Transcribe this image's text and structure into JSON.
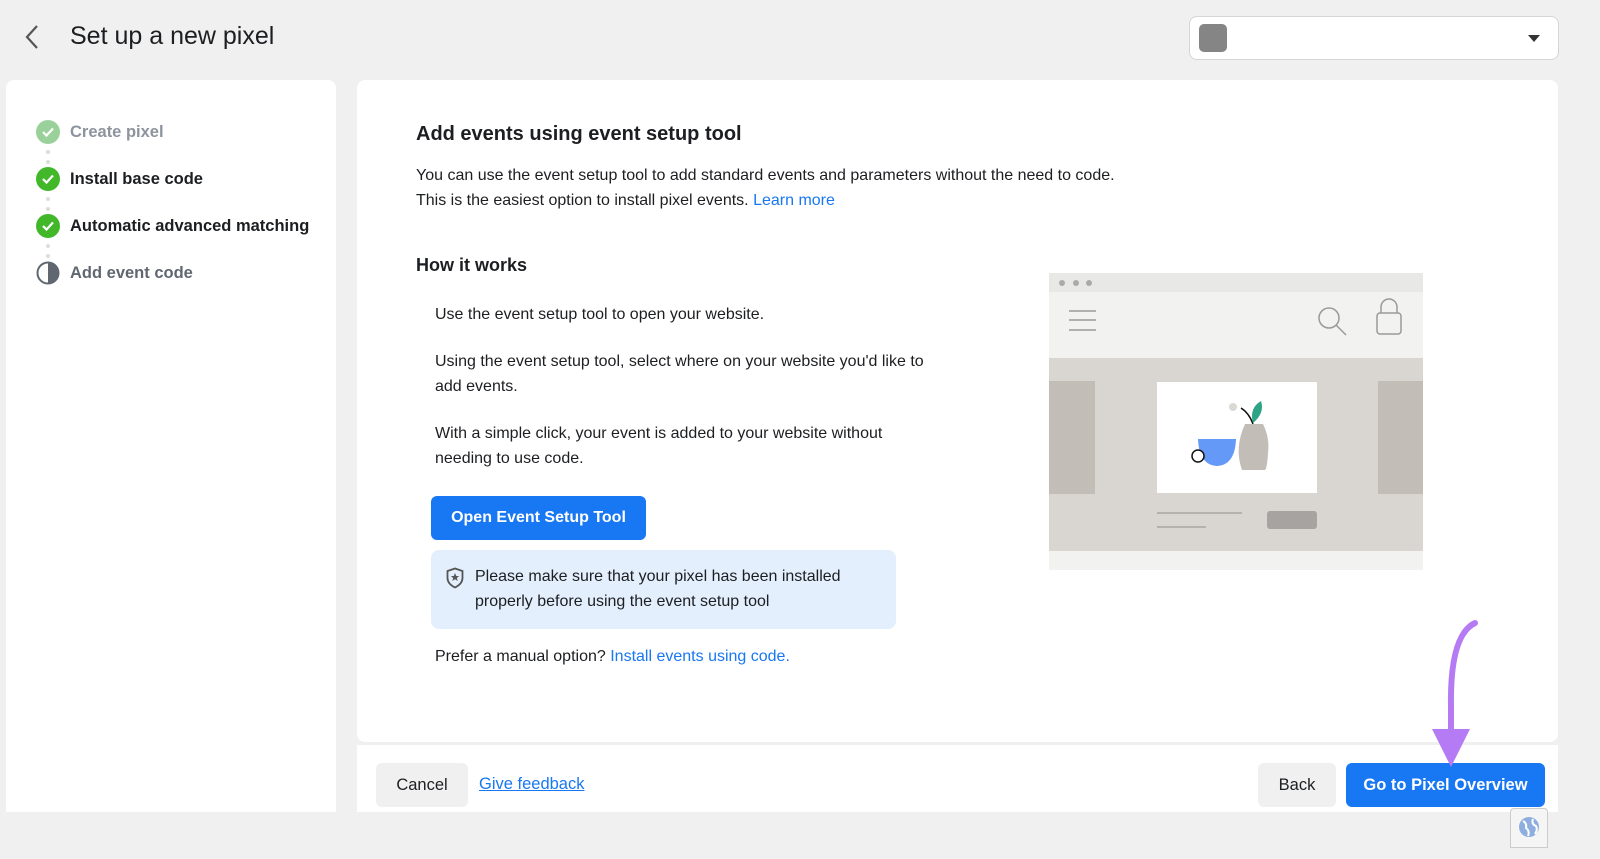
{
  "header": {
    "title": "Set up a new pixel",
    "back_icon": "chevron-left-icon",
    "account_selector_icon": "account-avatar-square"
  },
  "sidebar": {
    "steps": [
      {
        "label": "Create pixel",
        "status": "complete-faded",
        "color": "#9ad19a"
      },
      {
        "label": "Install base code",
        "status": "complete",
        "color": "#42b72a"
      },
      {
        "label": "Automatic advanced matching",
        "status": "complete",
        "color": "#42b72a"
      },
      {
        "label": "Add event code",
        "status": "in-progress"
      }
    ]
  },
  "main": {
    "title": "Add events using event setup tool",
    "intro": "You can use the event setup tool to add standard events and parameters without the need to code. This is the easiest option to install pixel events.",
    "learn_more": "Learn more",
    "how_title": "How it works",
    "steps": [
      "Use the event setup tool to open your website.",
      "Using the event setup tool, select where on your website you'd like to add events.",
      "With a simple click, your event is added to your website without needing to use code."
    ],
    "open_tool_button": "Open Event Setup Tool",
    "note": "Please make sure that your pixel has been installed properly before using the event setup tool",
    "note_icon": "shield-star-icon",
    "manual_prefix": "Prefer a manual option?",
    "manual_link": "Install events using code."
  },
  "footer": {
    "cancel": "Cancel",
    "feedback": "Give feedback",
    "back": "Back",
    "primary": "Go to Pixel Overview"
  },
  "colors": {
    "accent": "#1877f2",
    "annotation_arrow": "#b57bf5"
  }
}
